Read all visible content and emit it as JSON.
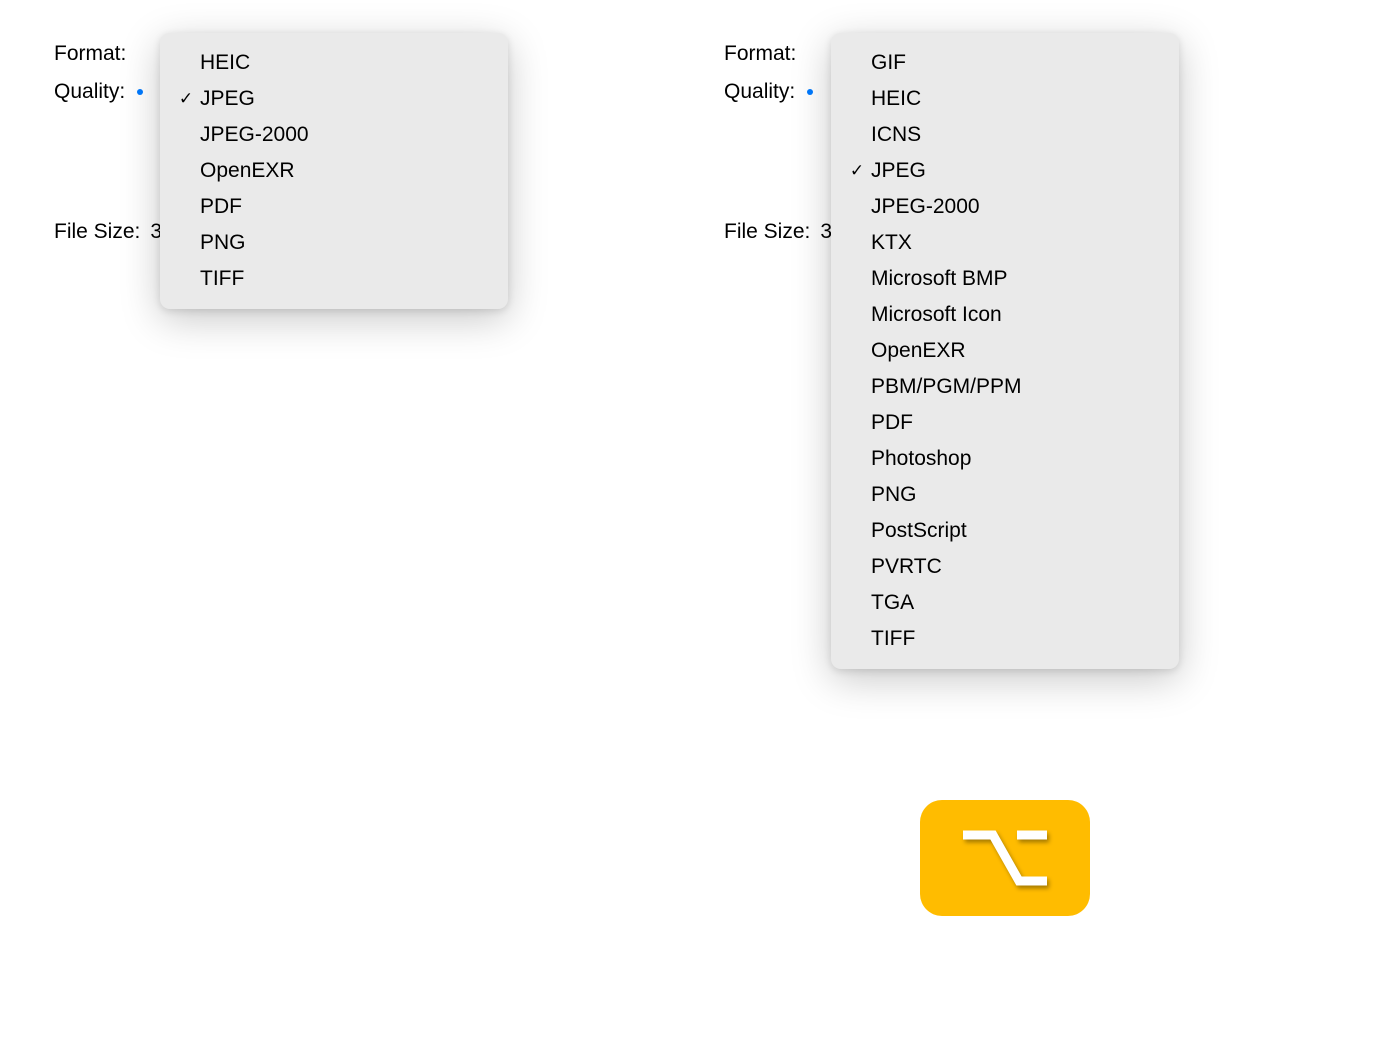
{
  "left": {
    "labels": {
      "format": "Format:",
      "quality": "Quality:",
      "filesize": "File Size:"
    },
    "filesize_value": "3",
    "dropdown": {
      "items": [
        {
          "label": "HEIC",
          "selected": false
        },
        {
          "label": "JPEG",
          "selected": true
        },
        {
          "label": "JPEG-2000",
          "selected": false
        },
        {
          "label": "OpenEXR",
          "selected": false
        },
        {
          "label": "PDF",
          "selected": false
        },
        {
          "label": "PNG",
          "selected": false
        },
        {
          "label": "TIFF",
          "selected": false
        }
      ]
    }
  },
  "right": {
    "labels": {
      "format": "Format:",
      "quality": "Quality:",
      "filesize": "File Size:"
    },
    "filesize_value": "3",
    "dropdown": {
      "items": [
        {
          "label": "GIF",
          "selected": false
        },
        {
          "label": "HEIC",
          "selected": false
        },
        {
          "label": "ICNS",
          "selected": false
        },
        {
          "label": "JPEG",
          "selected": true
        },
        {
          "label": "JPEG-2000",
          "selected": false
        },
        {
          "label": "KTX",
          "selected": false
        },
        {
          "label": "Microsoft BMP",
          "selected": false
        },
        {
          "label": "Microsoft Icon",
          "selected": false
        },
        {
          "label": "OpenEXR",
          "selected": false
        },
        {
          "label": "PBM/PGM/PPM",
          "selected": false
        },
        {
          "label": "PDF",
          "selected": false
        },
        {
          "label": "Photoshop",
          "selected": false
        },
        {
          "label": "PNG",
          "selected": false
        },
        {
          "label": "PostScript",
          "selected": false
        },
        {
          "label": "PVRTC",
          "selected": false
        },
        {
          "label": "TGA",
          "selected": false
        },
        {
          "label": "TIFF",
          "selected": false
        }
      ]
    }
  },
  "icon": {
    "name": "option-key-icon"
  }
}
